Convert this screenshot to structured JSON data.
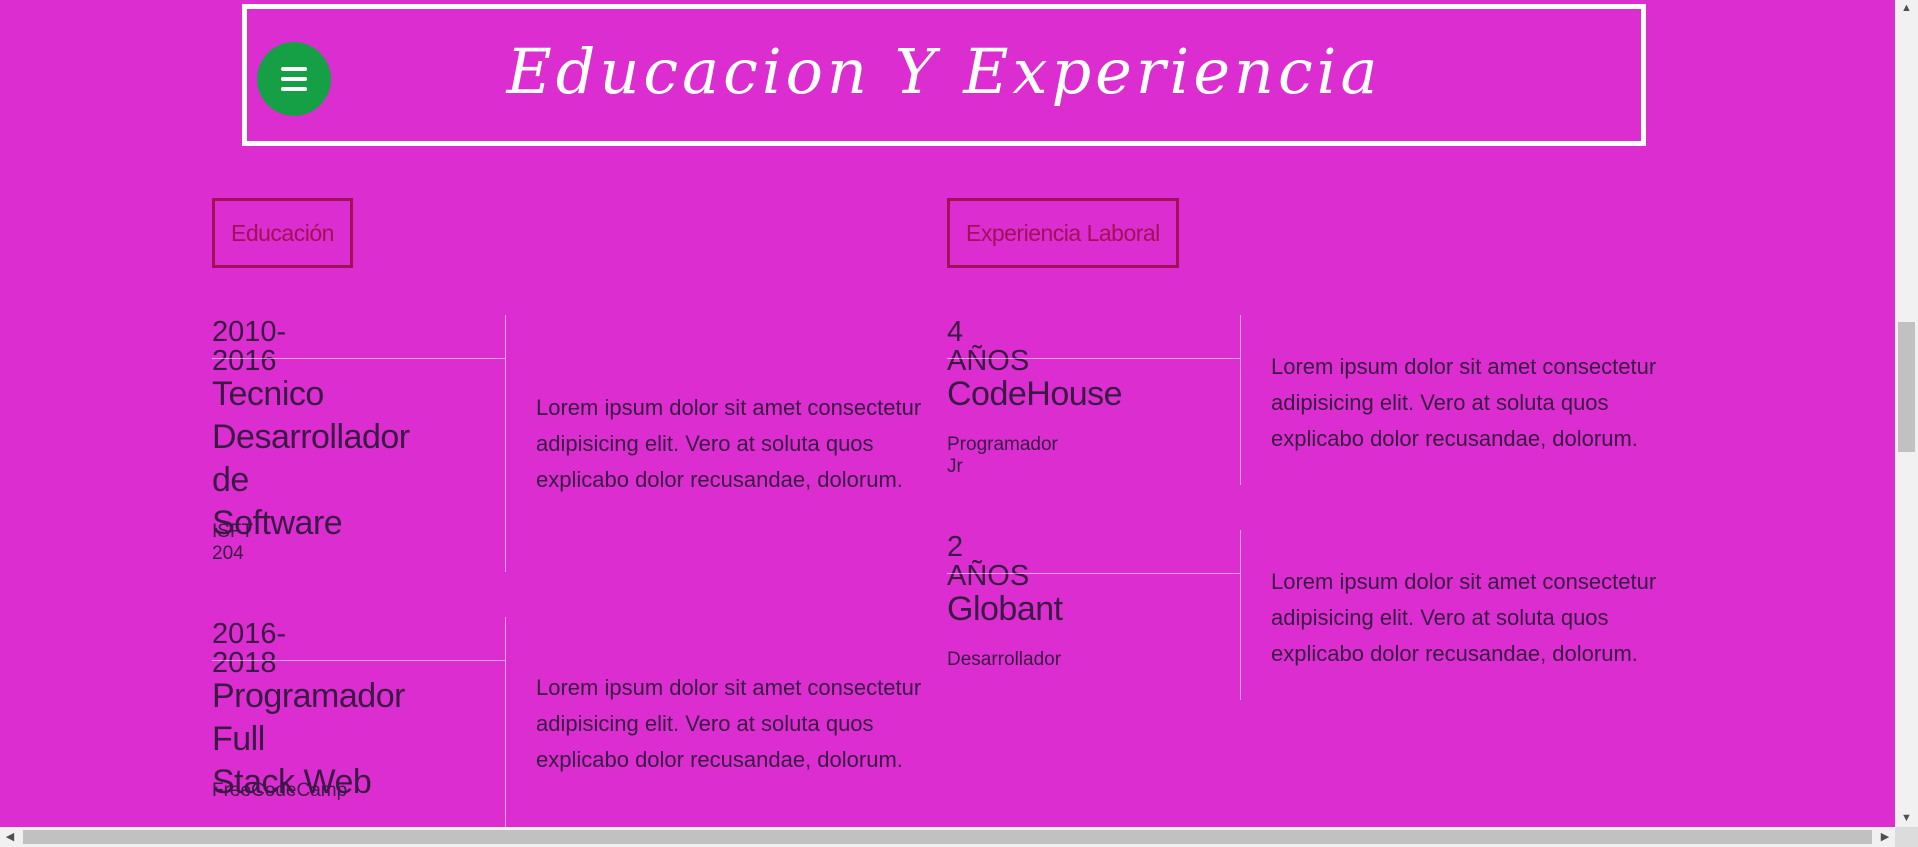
{
  "header": {
    "title": "Educacion Y Experiencia",
    "menu_icon": "hamburger-icon"
  },
  "colors": {
    "background": "#dc2dd0",
    "accent": "#a3105a",
    "menu_button": "#16a045",
    "frame": "#ffffff",
    "text": "#3a1a44"
  },
  "education": {
    "label": "Educación",
    "items": [
      {
        "period": "2010-2016",
        "title": "Tecnico Desarrollador de Software",
        "title_lines": [
          "Tecnico",
          "Desarrollador de",
          "Software"
        ],
        "institution": "ISFT 204",
        "description": "Lorem ipsum dolor sit amet consectetur adipisicing elit. Vero at soluta quos explicabo dolor recusandae, dolorum."
      },
      {
        "period": "2016-2018",
        "title": "Programador Full Stack Web",
        "title_lines": [
          "Programador Full",
          "Stack Web"
        ],
        "institution": "FreeCodeCamp",
        "description": "Lorem ipsum dolor sit amet consectetur adipisicing elit. Vero at soluta quos explicabo dolor recusandae, dolorum."
      }
    ]
  },
  "experience": {
    "label": "Experiencia Laboral",
    "items": [
      {
        "period": "4 AÑOS",
        "company": "CodeHouse",
        "role": "Programador Jr",
        "description": "Lorem ipsum dolor sit amet consectetur adipisicing elit. Vero at soluta quos explicabo dolor recusandae, dolorum."
      },
      {
        "period": "2 AÑOS",
        "company": "Globant",
        "role": "Desarrollador",
        "description": "Lorem ipsum dolor sit amet consectetur adipisicing elit. Vero at soluta quos explicabo dolor recusandae, dolorum."
      }
    ]
  }
}
